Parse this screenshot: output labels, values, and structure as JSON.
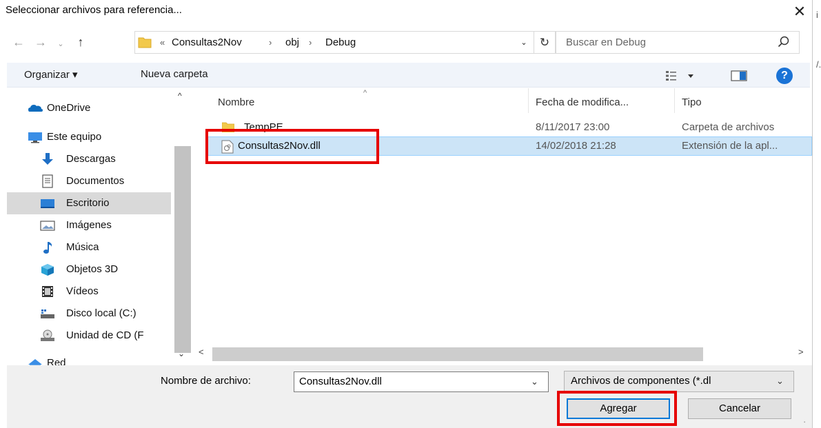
{
  "window": {
    "title": "Seleccionar archivos para referencia...",
    "close_glyph": "✕",
    "edge_glyph_top": "i",
    "edge_glyph_mid": "/."
  },
  "nav": {
    "back_glyph": "←",
    "forward_glyph": "→",
    "recent_glyph": "⌄",
    "up_glyph": "↑",
    "breadcrumb": {
      "overflow": "«",
      "items": [
        "Consultas2Nov",
        "obj",
        "Debug"
      ],
      "separator": "›"
    },
    "refresh_glyph": "↻",
    "dropdown_glyph": "⌄",
    "search_placeholder": "Buscar en Debug"
  },
  "toolbar": {
    "organize_label": "Organizar ▾",
    "new_folder_label": "Nueva carpeta",
    "help_label": "?"
  },
  "navpane": {
    "scroll_up": "^",
    "scroll_down": "⌄",
    "items": [
      {
        "label": "OneDrive",
        "icon": "onedrive-icon"
      },
      {
        "label": "Este equipo",
        "icon": "computer-icon"
      },
      {
        "label": "Descargas",
        "icon": "downloads-icon"
      },
      {
        "label": "Documentos",
        "icon": "documents-icon"
      },
      {
        "label": "Escritorio",
        "icon": "desktop-icon",
        "selected": true
      },
      {
        "label": "Imágenes",
        "icon": "pictures-icon"
      },
      {
        "label": "Música",
        "icon": "music-icon"
      },
      {
        "label": "Objetos 3D",
        "icon": "objects3d-icon"
      },
      {
        "label": "Vídeos",
        "icon": "videos-icon"
      },
      {
        "label": "Disco local (C:)",
        "icon": "local-disk-icon"
      },
      {
        "label": "Unidad de CD (F",
        "icon": "cd-drive-icon"
      },
      {
        "label": "Red",
        "icon": "network-icon"
      }
    ]
  },
  "filelist": {
    "columns": [
      "Nombre",
      "Fecha de modifica...",
      "Tipo"
    ],
    "sort_glyph": "^",
    "rows": [
      {
        "name": "TempPE",
        "date": "8/11/2017 23:00",
        "type": "Carpeta de archivos",
        "icon": "folder-icon"
      },
      {
        "name": "Consultas2Nov.dll",
        "date": "14/02/2018 21:28",
        "type": "Extensión de la apl...",
        "icon": "dll-file-icon",
        "selected": true
      }
    ],
    "hscroll_left": "<",
    "hscroll_right": ">"
  },
  "footer": {
    "filename_label": "Nombre de archivo:",
    "filename_value": "Consultas2Nov.dll",
    "filter_value": "Archivos de componentes (*.dl",
    "dropdown_glyph": "⌄",
    "add_label": "Agregar",
    "cancel_label": "Cancelar",
    "grip_glyph": "⠠"
  },
  "colors": {
    "selection": "#cce4f7",
    "highlight": "#e60000",
    "accent": "#0078d7"
  }
}
